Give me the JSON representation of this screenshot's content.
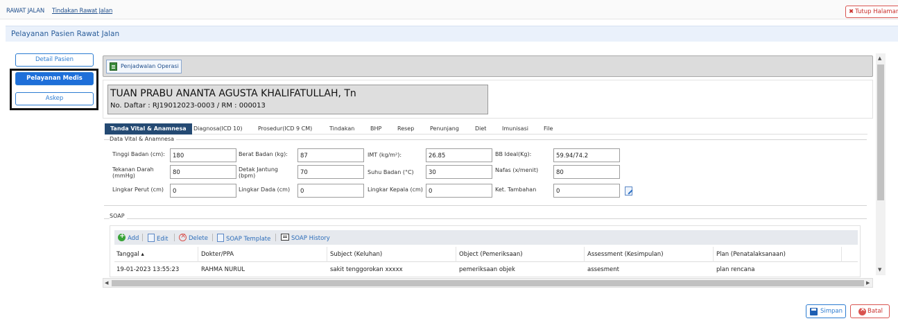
{
  "breadcrumb": {
    "root": "RAWAT JALAN",
    "current": "Tindakan Rawat Jalan"
  },
  "close_page": {
    "label": "Tutup Halaman",
    "icon": "close-icon"
  },
  "panel": {
    "title": "Pelayanan Pasien Rawat Jalan"
  },
  "left_menu": {
    "items": [
      {
        "label": "Detail Pasien",
        "active": false
      },
      {
        "label": "Pelayanan Medis",
        "active": true
      },
      {
        "label": "Askep",
        "active": false
      }
    ]
  },
  "toolbar": {
    "schedule_op_label": "Penjadwalan Operasi",
    "icon": "spreadsheet-icon"
  },
  "patient": {
    "name": "TUAN PRABU ANANTA AGUSTA KHALIFATULLAH, Tn",
    "registration": "No. Daftar : RJ19012023-0003 / RM : 000013"
  },
  "tabs": [
    {
      "label": "Tanda Vital & Anamnesa",
      "active": true
    },
    {
      "label": "Diagnosa(ICD 10)"
    },
    {
      "label": "Prosedur(ICD 9 CM)"
    },
    {
      "label": "Tindakan"
    },
    {
      "label": "BHP"
    },
    {
      "label": "Resep"
    },
    {
      "label": "Penunjang"
    },
    {
      "label": "Diet"
    },
    {
      "label": "Imunisasi"
    },
    {
      "label": "File"
    }
  ],
  "vitals": {
    "legend": "Data Vital & Anamnesa",
    "tinggi_badan": {
      "label": "Tinggi Badan (cm):",
      "value": "180"
    },
    "berat_badan": {
      "label": "Berat Badan (kg):",
      "value": "87"
    },
    "imt": {
      "label": "IMT (kg/m²):",
      "value": "26.85"
    },
    "bb_ideal": {
      "label": "BB Ideal(Kg):",
      "value": "59.94/74.2"
    },
    "tekanan_darah": {
      "label": "Tekanan Darah (mmHg)",
      "value": "80"
    },
    "detak_jantung": {
      "label": "Detak Jantung (bpm)",
      "value": "70"
    },
    "suhu_badan": {
      "label": "Suhu Badan (°C)",
      "value": "30"
    },
    "nafas": {
      "label": "Nafas (x/menit)",
      "value": "80"
    },
    "lingkar_perut": {
      "label": "Lingkar Perut (cm)",
      "value": "0"
    },
    "lingkar_dada": {
      "label": "Lingkar Dada (cm)",
      "value": "0"
    },
    "lingkar_kepala": {
      "label": "Lingkar Kepala (cm)",
      "value": "0"
    },
    "ket_tambahan": {
      "label": "Ket. Tambahan",
      "value": "0"
    }
  },
  "soap": {
    "legend": "SOAP",
    "tools": {
      "add": "Add",
      "edit": "Edit",
      "delete": "Delete",
      "template": "SOAP Template",
      "history": "SOAP History"
    },
    "columns": [
      "Tanggal ▴",
      "Dokter/PPA",
      "Subject (Keluhan)",
      "Object (Pemeriksaan)",
      "Assessment (Kesimpulan)",
      "Plan (Penatalaksanaan)"
    ],
    "rows": [
      [
        "19-01-2023 13:55:23",
        "RAHMA NURUL",
        "sakit tenggorokan xxxxx",
        "pemeriksaan objek",
        "assesment",
        "plan rencana"
      ]
    ]
  },
  "footer": {
    "save_label": "Simpan",
    "cancel_label": "Batal"
  },
  "colors": {
    "accent": "#1e6fd9",
    "tab_active": "#244a73",
    "danger": "#d9534f",
    "link": "#1f4e8c"
  }
}
